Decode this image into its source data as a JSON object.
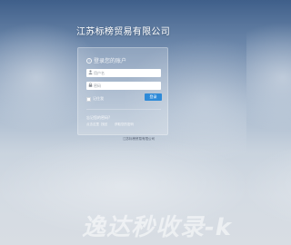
{
  "company": {
    "title": "江苏标榜贸易有限公司"
  },
  "login": {
    "heading": "登录您的账户",
    "username_placeholder": "用户名",
    "password_placeholder": "密码",
    "remember_label": "记住我",
    "submit_label": "登录"
  },
  "help": {
    "title": "忘记您的密码?",
    "links": [
      "点击这里",
      "找回",
      "获取您的密码"
    ]
  },
  "footer": {
    "copyright": "江苏标榜贸易有限公司"
  },
  "watermark": {
    "text": "逸达秒收录-k"
  },
  "colors": {
    "accent": "#2e8ad8",
    "title": "#ffffff"
  },
  "icons": {
    "heading": "info-icon",
    "username": "user-icon",
    "password": "lock-icon"
  }
}
